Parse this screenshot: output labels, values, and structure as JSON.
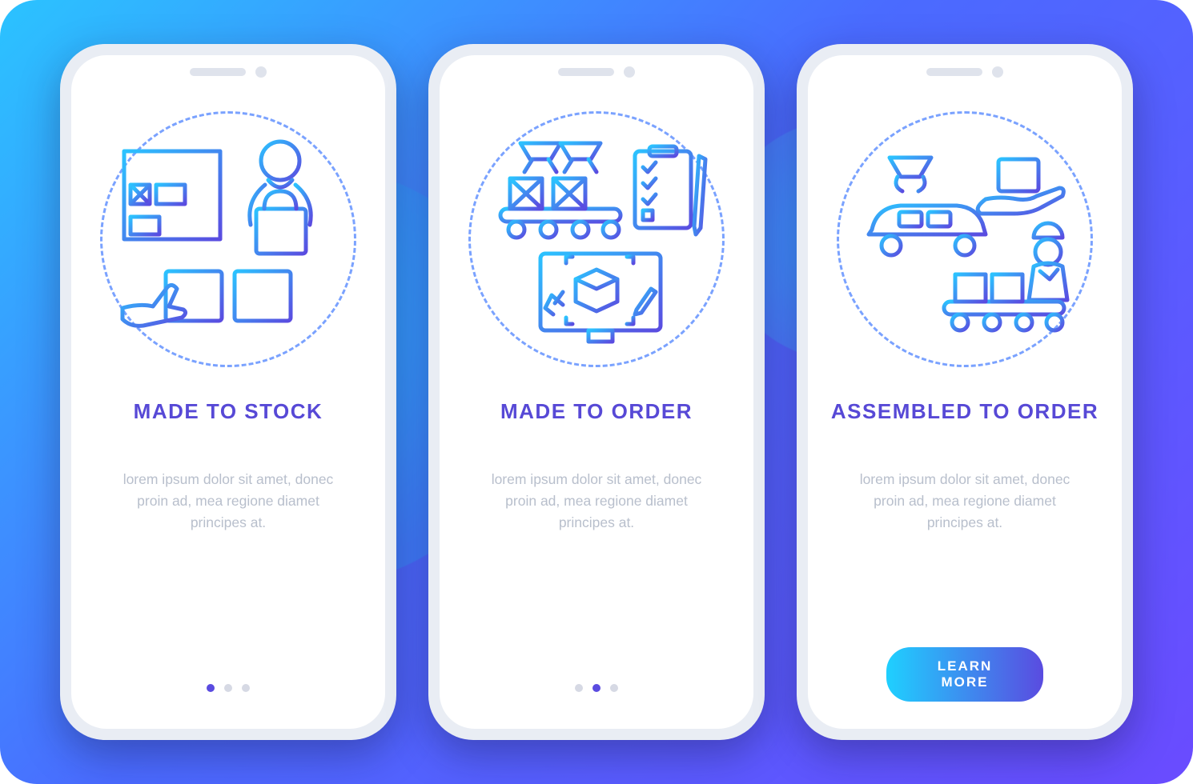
{
  "screens": [
    {
      "icon": "made-to-stock-icon",
      "heading": "MADE TO STOCK",
      "body": "lorem ipsum dolor sit amet, donec proin ad, mea regione diamet principes at.",
      "pager_active_index": 0,
      "has_cta": false
    },
    {
      "icon": "made-to-order-icon",
      "heading": "MADE TO ORDER",
      "body": "lorem ipsum dolor sit amet, donec proin ad, mea regione diamet principes at.",
      "pager_active_index": 1,
      "has_cta": false
    },
    {
      "icon": "assembled-to-order-icon",
      "heading": "ASSEMBLED TO ORDER",
      "body": "lorem ipsum dolor sit amet, donec proin ad, mea regione diamet principes at.",
      "pager_active_index": 2,
      "has_cta": true
    }
  ],
  "cta_label": "LEARN MORE",
  "colors": {
    "accent": "#5749d6",
    "body_text": "#b8bfcc",
    "dot_inactive": "#d6d9e4",
    "dot_active": "#5a4be0",
    "cta_gradient_start": "#1fd0ff",
    "cta_gradient_end": "#5a4be0"
  }
}
